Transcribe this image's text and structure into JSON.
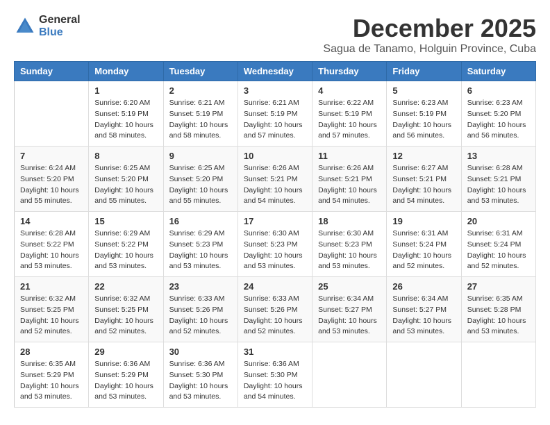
{
  "logo": {
    "general": "General",
    "blue": "Blue"
  },
  "title": "December 2025",
  "location": "Sagua de Tanamo, Holguin Province, Cuba",
  "headers": [
    "Sunday",
    "Monday",
    "Tuesday",
    "Wednesday",
    "Thursday",
    "Friday",
    "Saturday"
  ],
  "weeks": [
    [
      {
        "day": "",
        "info": ""
      },
      {
        "day": "1",
        "info": "Sunrise: 6:20 AM\nSunset: 5:19 PM\nDaylight: 10 hours\nand 58 minutes."
      },
      {
        "day": "2",
        "info": "Sunrise: 6:21 AM\nSunset: 5:19 PM\nDaylight: 10 hours\nand 58 minutes."
      },
      {
        "day": "3",
        "info": "Sunrise: 6:21 AM\nSunset: 5:19 PM\nDaylight: 10 hours\nand 57 minutes."
      },
      {
        "day": "4",
        "info": "Sunrise: 6:22 AM\nSunset: 5:19 PM\nDaylight: 10 hours\nand 57 minutes."
      },
      {
        "day": "5",
        "info": "Sunrise: 6:23 AM\nSunset: 5:19 PM\nDaylight: 10 hours\nand 56 minutes."
      },
      {
        "day": "6",
        "info": "Sunrise: 6:23 AM\nSunset: 5:20 PM\nDaylight: 10 hours\nand 56 minutes."
      }
    ],
    [
      {
        "day": "7",
        "info": "Sunrise: 6:24 AM\nSunset: 5:20 PM\nDaylight: 10 hours\nand 55 minutes."
      },
      {
        "day": "8",
        "info": "Sunrise: 6:25 AM\nSunset: 5:20 PM\nDaylight: 10 hours\nand 55 minutes."
      },
      {
        "day": "9",
        "info": "Sunrise: 6:25 AM\nSunset: 5:20 PM\nDaylight: 10 hours\nand 55 minutes."
      },
      {
        "day": "10",
        "info": "Sunrise: 6:26 AM\nSunset: 5:21 PM\nDaylight: 10 hours\nand 54 minutes."
      },
      {
        "day": "11",
        "info": "Sunrise: 6:26 AM\nSunset: 5:21 PM\nDaylight: 10 hours\nand 54 minutes."
      },
      {
        "day": "12",
        "info": "Sunrise: 6:27 AM\nSunset: 5:21 PM\nDaylight: 10 hours\nand 54 minutes."
      },
      {
        "day": "13",
        "info": "Sunrise: 6:28 AM\nSunset: 5:21 PM\nDaylight: 10 hours\nand 53 minutes."
      }
    ],
    [
      {
        "day": "14",
        "info": "Sunrise: 6:28 AM\nSunset: 5:22 PM\nDaylight: 10 hours\nand 53 minutes."
      },
      {
        "day": "15",
        "info": "Sunrise: 6:29 AM\nSunset: 5:22 PM\nDaylight: 10 hours\nand 53 minutes."
      },
      {
        "day": "16",
        "info": "Sunrise: 6:29 AM\nSunset: 5:23 PM\nDaylight: 10 hours\nand 53 minutes."
      },
      {
        "day": "17",
        "info": "Sunrise: 6:30 AM\nSunset: 5:23 PM\nDaylight: 10 hours\nand 53 minutes."
      },
      {
        "day": "18",
        "info": "Sunrise: 6:30 AM\nSunset: 5:23 PM\nDaylight: 10 hours\nand 53 minutes."
      },
      {
        "day": "19",
        "info": "Sunrise: 6:31 AM\nSunset: 5:24 PM\nDaylight: 10 hours\nand 52 minutes."
      },
      {
        "day": "20",
        "info": "Sunrise: 6:31 AM\nSunset: 5:24 PM\nDaylight: 10 hours\nand 52 minutes."
      }
    ],
    [
      {
        "day": "21",
        "info": "Sunrise: 6:32 AM\nSunset: 5:25 PM\nDaylight: 10 hours\nand 52 minutes."
      },
      {
        "day": "22",
        "info": "Sunrise: 6:32 AM\nSunset: 5:25 PM\nDaylight: 10 hours\nand 52 minutes."
      },
      {
        "day": "23",
        "info": "Sunrise: 6:33 AM\nSunset: 5:26 PM\nDaylight: 10 hours\nand 52 minutes."
      },
      {
        "day": "24",
        "info": "Sunrise: 6:33 AM\nSunset: 5:26 PM\nDaylight: 10 hours\nand 52 minutes."
      },
      {
        "day": "25",
        "info": "Sunrise: 6:34 AM\nSunset: 5:27 PM\nDaylight: 10 hours\nand 53 minutes."
      },
      {
        "day": "26",
        "info": "Sunrise: 6:34 AM\nSunset: 5:27 PM\nDaylight: 10 hours\nand 53 minutes."
      },
      {
        "day": "27",
        "info": "Sunrise: 6:35 AM\nSunset: 5:28 PM\nDaylight: 10 hours\nand 53 minutes."
      }
    ],
    [
      {
        "day": "28",
        "info": "Sunrise: 6:35 AM\nSunset: 5:29 PM\nDaylight: 10 hours\nand 53 minutes."
      },
      {
        "day": "29",
        "info": "Sunrise: 6:36 AM\nSunset: 5:29 PM\nDaylight: 10 hours\nand 53 minutes."
      },
      {
        "day": "30",
        "info": "Sunrise: 6:36 AM\nSunset: 5:30 PM\nDaylight: 10 hours\nand 53 minutes."
      },
      {
        "day": "31",
        "info": "Sunrise: 6:36 AM\nSunset: 5:30 PM\nDaylight: 10 hours\nand 54 minutes."
      },
      {
        "day": "",
        "info": ""
      },
      {
        "day": "",
        "info": ""
      },
      {
        "day": "",
        "info": ""
      }
    ]
  ]
}
